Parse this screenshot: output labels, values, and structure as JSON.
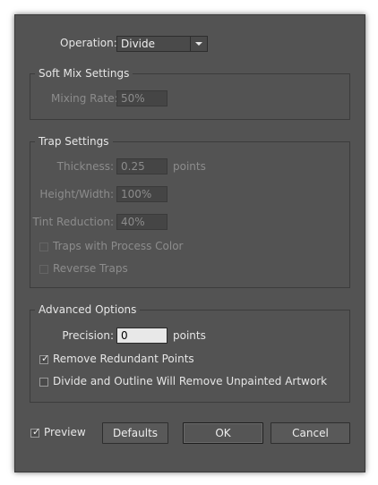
{
  "operation": {
    "label": "Operation:",
    "value": "Divide"
  },
  "soft_mix": {
    "title": "Soft Mix Settings",
    "mixing_rate_label": "Mixing Rate:",
    "mixing_rate_value": "50%"
  },
  "trap": {
    "title": "Trap Settings",
    "thickness_label": "Thickness:",
    "thickness_value": "0.25",
    "thickness_unit": "points",
    "height_width_label": "Height/Width:",
    "height_width_value": "100%",
    "tint_reduction_label": "Tint Reduction:",
    "tint_reduction_value": "40%",
    "process_color_label": "Traps with Process Color",
    "reverse_traps_label": "Reverse Traps"
  },
  "advanced": {
    "title": "Advanced Options",
    "precision_label": "Precision:",
    "precision_value": "0",
    "precision_unit": "points",
    "remove_redundant_label": "Remove Redundant Points",
    "remove_redundant_checked": true,
    "divide_outline_label": "Divide and Outline Will Remove Unpainted Artwork",
    "divide_outline_checked": false
  },
  "footer": {
    "preview_label": "Preview",
    "preview_checked": true,
    "defaults_label": "Defaults",
    "ok_label": "OK",
    "cancel_label": "Cancel"
  },
  "icons": {
    "dropdown": "chevron-down-icon",
    "check": "check-icon"
  },
  "colors": {
    "panel": "#535353",
    "text": "#e6e6e6",
    "disabled_text": "#8c8c8c",
    "active_field": "#e8e8e8"
  }
}
